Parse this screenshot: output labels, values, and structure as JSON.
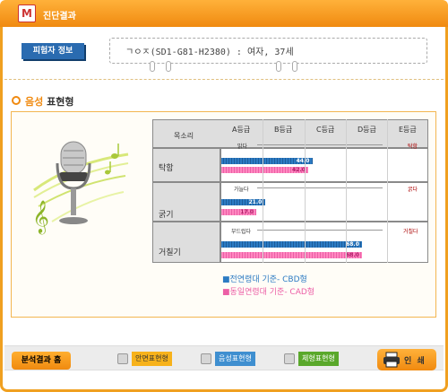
{
  "window": {
    "title": "진단결과"
  },
  "subject": {
    "tab_label": "피험자 정보",
    "info": "ㄱㅇㅈ(SD1-G81-H2380) : 여자, 37세"
  },
  "section": {
    "title_accent": "음성",
    "title_rest": " 표현형"
  },
  "table": {
    "header_label": "목소리",
    "grades": [
      "A등급",
      "B등급",
      "C등급",
      "D등급",
      "E등급"
    ],
    "rows": [
      {
        "name": "탁함",
        "left": "맑다",
        "right": "탁함",
        "cbd": 44.0,
        "cbd_text": "44.0",
        "cad": 42.0,
        "cad_text": "42.0"
      },
      {
        "name": "굵기",
        "left": "가늘다",
        "right": "굵다",
        "cbd": 21.0,
        "cbd_text": "21.0",
        "cad": 17.0,
        "cad_text": "17.0"
      },
      {
        "name": "거칠기",
        "left": "부드럽다",
        "right": "거칠다",
        "cbd": 68.0,
        "cbd_text": "68.0",
        "cad": 68.0,
        "cad_text": "68.0"
      }
    ]
  },
  "legend": {
    "cbd": "■전연령대 기준- CBD형",
    "cad": "■동일연령대 기준- CAD형"
  },
  "footer": {
    "home_button": "분석결과 홈",
    "face_button": "안면표현형",
    "voice_button": "음성표현형",
    "body_button": "체형표현형",
    "print_button": "인  쇄"
  },
  "colors": {
    "accent": "#f08a10",
    "cbd": "#2c7bc3",
    "cad": "#ec5fa6",
    "face_btn": "#f7b21b",
    "voice_btn": "#3f8fd0",
    "body_btn": "#5aa82b"
  },
  "icons": {
    "title": "logo-icon",
    "print": "printer-icon",
    "microphone": "microphone-illustration"
  }
}
